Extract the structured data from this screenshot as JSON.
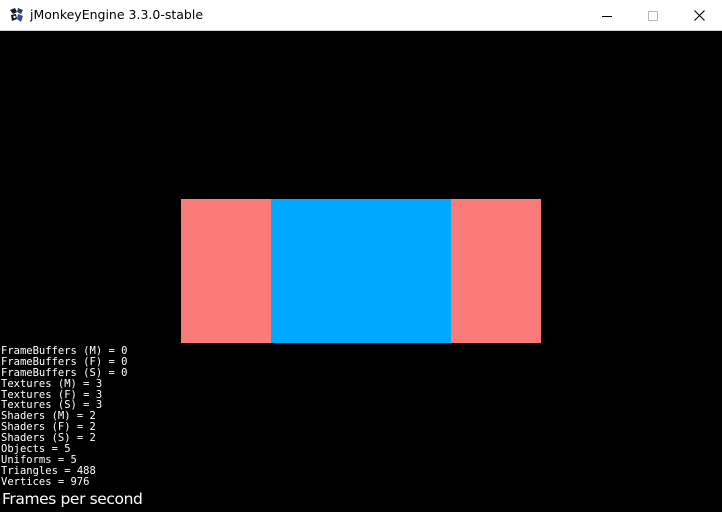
{
  "window": {
    "title": "jMonkeyEngine 3.3.0-stable",
    "icon": "jmonkeyengine-logo-icon",
    "controls": {
      "minimize_icon": "minimize-icon",
      "maximize_icon": "maximize-icon",
      "close_icon": "close-icon"
    }
  },
  "scene": {
    "background_color": "#000000",
    "left_quad_color": "#fb7b7b",
    "center_quad_color": "#00a8ff",
    "right_quad_color": "#fb7b7b"
  },
  "stats": [
    "FrameBuffers (M) = 0",
    "FrameBuffers (F) = 0",
    "FrameBuffers (S) = 0",
    "Textures (M) = 3",
    "Textures (F) = 3",
    "Textures (S) = 3",
    "Shaders (M) = 2",
    "Shaders (F) = 2",
    "Shaders (S) = 2",
    "Objects = 5",
    "Uniforms = 5",
    "Triangles = 488",
    "Vertices = 976"
  ],
  "fps_label": "Frames per second"
}
